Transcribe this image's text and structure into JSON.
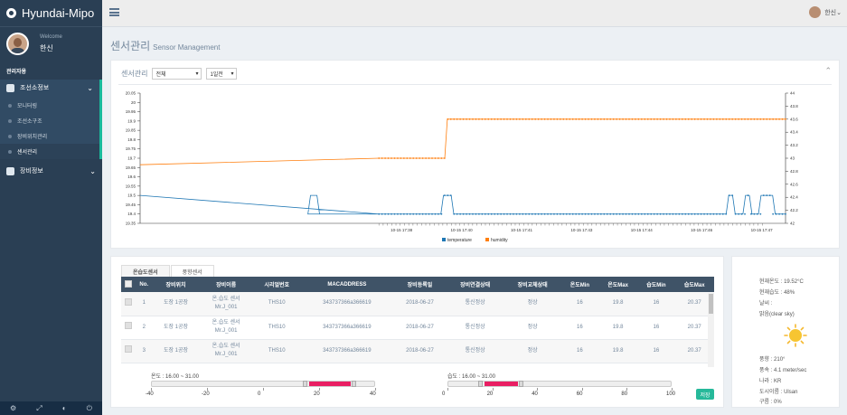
{
  "brand": {
    "name": "Hyundai-Mipo"
  },
  "profile": {
    "welcome": "Welcome",
    "name": "한신"
  },
  "sidebar": {
    "section": "관리자용",
    "menu1": "조선소정보",
    "items": [
      {
        "label": "모니터링"
      },
      {
        "label": "조선소구조"
      },
      {
        "label": "장비위치관리"
      },
      {
        "label": "센서관리"
      }
    ],
    "menu2": "장비정보"
  },
  "topbar": {
    "user": "한신"
  },
  "page": {
    "title": "센서관리",
    "subtitle": "Sensor Management"
  },
  "chart_panel": {
    "label": "센서관리",
    "filter1": "전체",
    "filter2": "1일전"
  },
  "chart_data": {
    "type": "line",
    "x_tick_labels": [
      "10-15 17:38",
      "10-15 17:40",
      "10-15 17:41",
      "10-15 17:43",
      "10-15 17:44",
      "10-15 17:46",
      "10-15 17:47"
    ],
    "y_left_ticks": [
      "20.05",
      "20",
      "19.95",
      "19.9",
      "19.85",
      "19.8",
      "19.75",
      "19.7",
      "19.65",
      "19.6",
      "19.55",
      "19.5",
      "19.45",
      "19.4",
      "19.35"
    ],
    "y_right_ticks": [
      "44",
      "43.8",
      "43.6",
      "43.4",
      "43.2",
      "43",
      "42.8",
      "42.6",
      "42.4",
      "42.2",
      "42"
    ],
    "ylim_left": [
      19.35,
      20.05
    ],
    "ylim_right": [
      42,
      44
    ],
    "series": [
      {
        "name": "temperature",
        "color": "#1f77b4",
        "axis": "left",
        "base": 19.4,
        "start": 19.5,
        "spike": 19.5,
        "spikes": [
          {
            "at": 0.264,
            "w": 0.01
          },
          {
            "at": 0.47,
            "w": 0.012
          },
          {
            "at": 0.912,
            "w": 0.006
          },
          {
            "at": 0.938,
            "w": 0.006
          },
          {
            "at": 0.962,
            "w": 0.018
          }
        ]
      },
      {
        "name": "humidity",
        "color": "#ff7f0e",
        "axis": "right",
        "start": 42.9,
        "level1": 43.0,
        "level2": 43.6,
        "step_at": 0.472
      }
    ],
    "grid": true,
    "legend": "bottom"
  },
  "table": {
    "tabs": [
      "온습도센서",
      "풍향센서"
    ],
    "headers": [
      "No.",
      "장비위치",
      "장비이름",
      "시리얼번호",
      "MACADDRESS",
      "장비등록일",
      "장비연결상태",
      "장비교체상태",
      "온도Min",
      "온도Max",
      "습도Min",
      "습도Max"
    ],
    "rows": [
      {
        "no": "1",
        "loc": "도장 1공장",
        "name1": "온.습도 센서",
        "name2": "Mr.J_001",
        "serial": "THS10",
        "mac": "343737366a366619",
        "date": "2018-06-27",
        "conn": "통신정상",
        "repl": "정상",
        "tmin": "16",
        "tmax": "19.8",
        "hmin": "16",
        "hmax": "20.37"
      },
      {
        "no": "2",
        "loc": "도장 1공장",
        "name1": "온.습도 센서",
        "name2": "Mr.J_001",
        "serial": "THS10",
        "mac": "343737366a366619",
        "date": "2018-06-27",
        "conn": "통신정상",
        "repl": "정상",
        "tmin": "16",
        "tmax": "19.8",
        "hmin": "16",
        "hmax": "20.37"
      },
      {
        "no": "3",
        "loc": "도장 1공장",
        "name1": "온.습도 센서",
        "name2": "Mr.J_001",
        "serial": "THS10",
        "mac": "343737366a366619",
        "date": "2018-06-27",
        "conn": "통신정상",
        "repl": "정상",
        "tmin": "16",
        "tmax": "19.8",
        "hmin": "16",
        "hmax": "20.37"
      }
    ]
  },
  "temp_slider": {
    "label": "온도 : 16.00 ~ 31.00",
    "min": -40,
    "max": 40,
    "from": 16,
    "to": 31,
    "ticks": [
      "-40",
      "-20",
      "0",
      "20",
      "40"
    ]
  },
  "hum_slider": {
    "label": "습도 : 16.00 ~ 31.00",
    "min": 0,
    "max": 100,
    "from": 16,
    "to": 31,
    "ticks": [
      "0",
      "20",
      "40",
      "60",
      "80",
      "100"
    ]
  },
  "save_label": "저장",
  "weather": {
    "temp": "현재온도 : 19.52°C",
    "humidity": "현재습도 : 48%",
    "cond_label": "날씨 :",
    "cond": "맑음(clear sky)",
    "wind_dir": "풍향 : 210°",
    "wind_speed": "풍속 : 4.1 meter/sec",
    "country": "나라 : KR",
    "city": "도시이름 : Ulsan",
    "clouds": "구름 : 0%"
  }
}
